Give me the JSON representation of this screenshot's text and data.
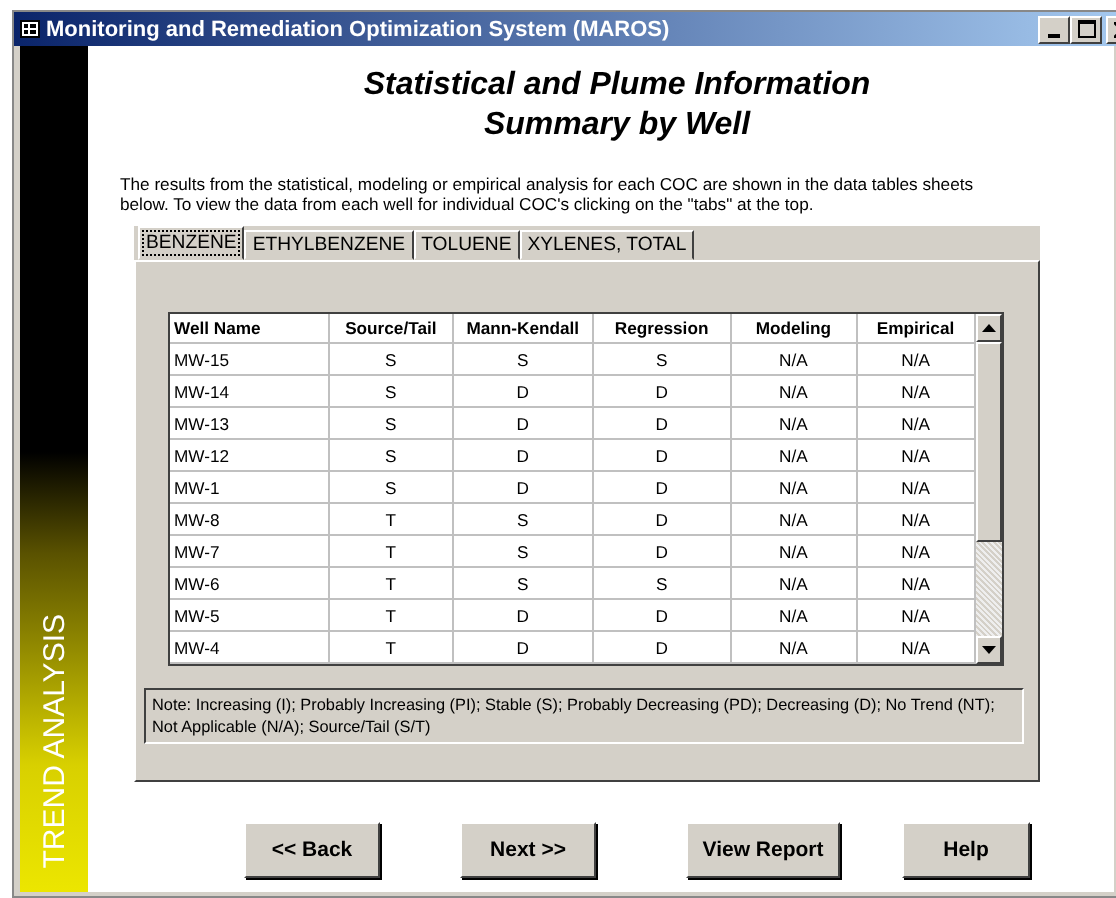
{
  "window": {
    "title": "Monitoring and Remediation Optimization System (MAROS)"
  },
  "sidebar": {
    "label": "TREND ANALYSIS"
  },
  "heading": [
    "Statistical and Plume Information",
    "Summary by Well"
  ],
  "description": "The results from the statistical, modeling  or empirical analysis for each COC are shown in the data tables sheets below. To view the data from each well for individual COC's clicking on the \"tabs\" at the top.",
  "tabs": [
    {
      "label": "BENZENE",
      "selected": true
    },
    {
      "label": "ETHYLBENZENE",
      "selected": false
    },
    {
      "label": "TOLUENE",
      "selected": false
    },
    {
      "label": "XYLENES, TOTAL",
      "selected": false
    }
  ],
  "table": {
    "columns": [
      "Well Name",
      "Source/Tail",
      "Mann-Kendall",
      "Regression",
      "Modeling",
      "Empirical"
    ],
    "rows": [
      [
        "MW-15",
        "S",
        "S",
        "S",
        "N/A",
        "N/A"
      ],
      [
        "MW-14",
        "S",
        "D",
        "D",
        "N/A",
        "N/A"
      ],
      [
        "MW-13",
        "S",
        "D",
        "D",
        "N/A",
        "N/A"
      ],
      [
        "MW-12",
        "S",
        "D",
        "D",
        "N/A",
        "N/A"
      ],
      [
        "MW-1",
        "S",
        "D",
        "D",
        "N/A",
        "N/A"
      ],
      [
        "MW-8",
        "T",
        "S",
        "D",
        "N/A",
        "N/A"
      ],
      [
        "MW-7",
        "T",
        "S",
        "D",
        "N/A",
        "N/A"
      ],
      [
        "MW-6",
        "T",
        "S",
        "S",
        "N/A",
        "N/A"
      ],
      [
        "MW-5",
        "T",
        "D",
        "D",
        "N/A",
        "N/A"
      ],
      [
        "MW-4",
        "T",
        "D",
        "D",
        "N/A",
        "N/A"
      ]
    ]
  },
  "note": "Note: Increasing (I); Probably Increasing (PI); Stable (S); Probably Decreasing (PD); Decreasing (D); No Trend (NT); Not Applicable (N/A); Source/Tail (S/T)",
  "buttons": [
    "<< Back",
    "Next >>",
    "View Report",
    "Help"
  ]
}
